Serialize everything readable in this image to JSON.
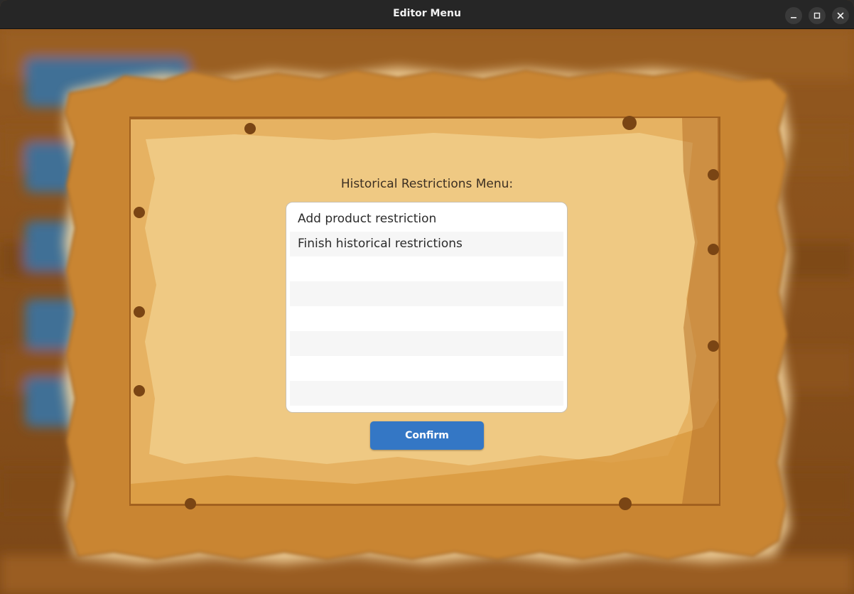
{
  "window": {
    "title": "Editor Menu",
    "controls": {
      "minimize_icon": "minimize-icon",
      "maximize_icon": "maximize-icon",
      "close_icon": "close-icon"
    }
  },
  "menu": {
    "heading": "Historical Restrictions Menu:",
    "items": [
      {
        "label": "Add product restriction"
      },
      {
        "label": "Finish historical restrictions"
      },
      {
        "label": ""
      },
      {
        "label": ""
      },
      {
        "label": ""
      },
      {
        "label": ""
      },
      {
        "label": ""
      },
      {
        "label": ""
      }
    ],
    "confirm_label": "Confirm"
  },
  "colors": {
    "titlebar": "#262626",
    "wood_background": "#8a5420",
    "parchment": "#e7b468",
    "confirm_button": "#3477c5",
    "list_background": "#ffffff"
  }
}
